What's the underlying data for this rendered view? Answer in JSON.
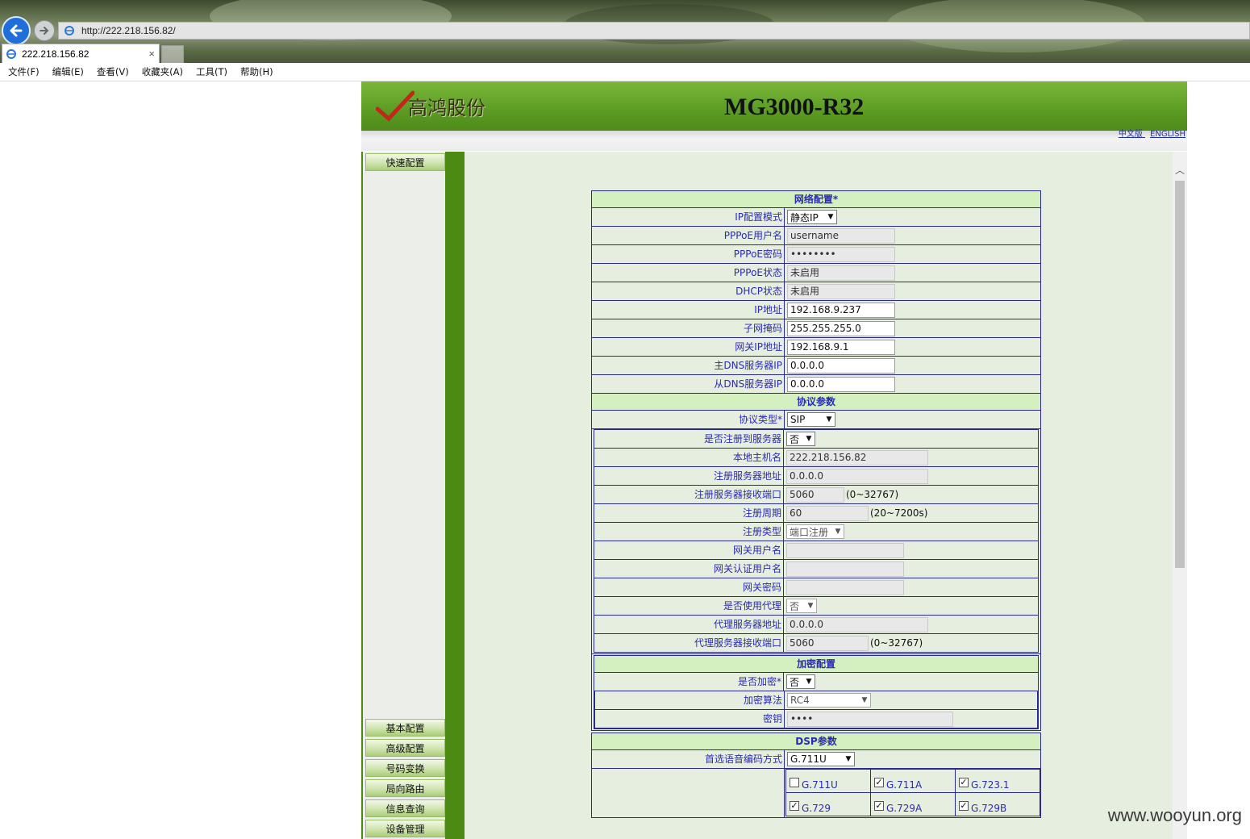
{
  "browser": {
    "url": "http://222.218.156.82/",
    "tab_title": "222.218.156.82",
    "tab_close": "×",
    "menu": [
      "文件(F)",
      "编辑(E)",
      "查看(V)",
      "收藏夹(A)",
      "工具(T)",
      "帮助(H)"
    ]
  },
  "header": {
    "logo_text": "高鸿股份",
    "product": "MG3000-R32",
    "lang_cn": "中文版",
    "lang_en": "ENGLISH"
  },
  "sidebar": {
    "top_item": "快速配置",
    "items": [
      "基本配置",
      "高级配置",
      "号码变换",
      "局向路由",
      "信息查询",
      "设备管理"
    ]
  },
  "network": {
    "title": "网络配置*",
    "ip_mode_label": "IP配置模式",
    "ip_mode_value": "静态IP",
    "pppoe_user_label": "PPPoE用户名",
    "pppoe_user_value": "username",
    "pppoe_pwd_label": "PPPoE密码",
    "pppoe_pwd_value": "••••••••",
    "pppoe_status_label": "PPPoE状态",
    "pppoe_status_value": "未启用",
    "dhcp_status_label": "DHCP状态",
    "dhcp_status_value": "未启用",
    "ip_label": "IP地址",
    "ip_value": "192.168.9.237",
    "mask_label": "子网掩码",
    "mask_value": "255.255.255.0",
    "gw_label": "网关IP地址",
    "gw_value": "192.168.9.1",
    "dns1_label": "主DNS服务器IP",
    "dns1_value": "0.0.0.0",
    "dns2_label": "从DNS服务器IP",
    "dns2_value": "0.0.0.0"
  },
  "protocol": {
    "title": "协议参数",
    "type_label": "协议类型*",
    "type_value": "SIP",
    "register_label": "是否注册到服务器",
    "register_value": "否",
    "hostname_label": "本地主机名",
    "hostname_value": "222.218.156.82",
    "reg_server_label": "注册服务器地址",
    "reg_server_value": "0.0.0.0",
    "reg_port_label": "注册服务器接收端口",
    "reg_port_value": "5060",
    "reg_port_range": "(0~32767)",
    "reg_period_label": "注册周期",
    "reg_period_value": "60",
    "reg_period_range": "(20~7200s)",
    "reg_type_label": "注册类型",
    "reg_type_value": "端口注册",
    "gw_user_label": "网关用户名",
    "gw_auth_label": "网关认证用户名",
    "gw_pwd_label": "网关密码",
    "use_proxy_label": "是否使用代理",
    "use_proxy_value": "否",
    "proxy_addr_label": "代理服务器地址",
    "proxy_addr_value": "0.0.0.0",
    "proxy_port_label": "代理服务器接收端口",
    "proxy_port_value": "5060",
    "proxy_port_range": "(0~32767)"
  },
  "encryption": {
    "title": "加密配置",
    "enable_label": "是否加密*",
    "enable_value": "否",
    "algo_label": "加密算法",
    "algo_value": "RC4",
    "key_label": "密钥",
    "key_value": "••••"
  },
  "dsp": {
    "title": "DSP参数",
    "codec_label": "首选语音编码方式",
    "codec_value": "G.711U",
    "codecs": [
      {
        "name": "G.711U",
        "checked": false
      },
      {
        "name": "G.711A",
        "checked": true
      },
      {
        "name": "G.723.1",
        "checked": true
      },
      {
        "name": "G.729",
        "checked": true
      },
      {
        "name": "G.729A",
        "checked": true
      },
      {
        "name": "G.729B",
        "checked": true
      }
    ],
    "check_mark": "✓"
  },
  "watermark": "www.wooyun.org"
}
